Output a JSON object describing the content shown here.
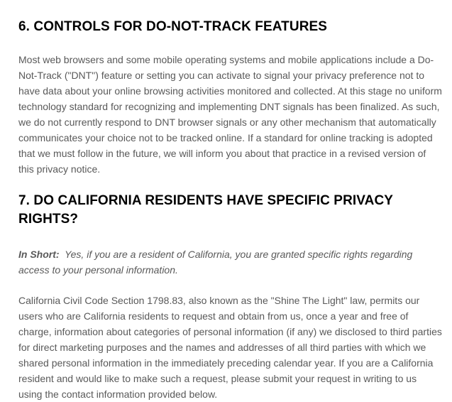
{
  "section6": {
    "heading": "6. CONTROLS FOR DO-NOT-TRACK FEATURES",
    "body": "Most web browsers and some mobile operating systems and mobile applications include a Do-Not-Track (\"DNT\") feature or setting you can activate to signal your privacy preference not to have data about your online browsing activities monitored and collected. At this stage no uniform technology standard for recognizing and implementing DNT signals has been finalized. As such, we do not currently respond to DNT browser signals or any other mechanism that automatically communicates your choice not to be tracked online. If a standard for online tracking is adopted that we must follow in the future, we will inform you about that practice in a revised version of this privacy notice."
  },
  "section7": {
    "heading": "7. DO CALIFORNIA RESIDENTS HAVE SPECIFIC PRIVACY RIGHTS?",
    "in_short_label": "In Short:",
    "in_short_text": "Yes, if you are a resident of California, you are granted specific rights regarding access to your personal information.",
    "body": "California Civil Code Section 1798.83, also known as the \"Shine The Light\" law, permits our users who are California residents to request and obtain from us, once a year and free of charge, information about categories of personal information (if any) we disclosed to third parties for direct marketing purposes and the names and addresses of all third parties with which we shared personal information in the immediately preceding calendar year. If you are a California resident and would like to make such a request, please submit your request in writing to us using the contact information provided below."
  }
}
